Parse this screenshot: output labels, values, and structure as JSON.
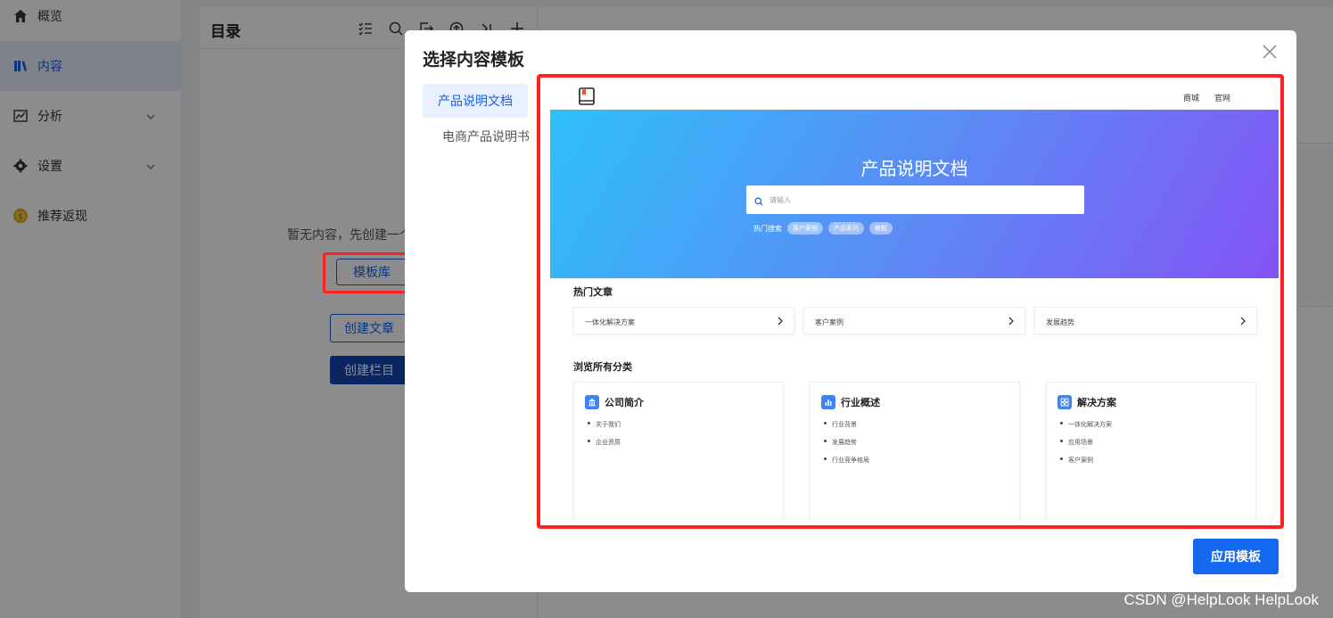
{
  "sidebar": {
    "items": [
      {
        "label": "概览",
        "icon": "home-icon"
      },
      {
        "label": "内容",
        "icon": "book-icon",
        "active": true
      },
      {
        "label": "分析",
        "icon": "chart-line-icon"
      },
      {
        "label": "设置",
        "icon": "gear-icon"
      },
      {
        "label": "推荐返现",
        "icon": "coin-icon"
      }
    ]
  },
  "directory": {
    "title": "目录",
    "empty_text": "暂无内容，先创建一个",
    "template_lib_button": "模板库",
    "create_article_button": "创建文章",
    "create_column_button": "创建栏目"
  },
  "modal": {
    "title": "选择内容模板",
    "templates": [
      {
        "label": "产品说明文档",
        "active": true
      },
      {
        "label": "电商产品说明书"
      }
    ],
    "apply_button": "应用模板",
    "preview": {
      "nav": [
        "商城",
        "官网"
      ],
      "hero_title": "产品说明文档",
      "search_placeholder": "请输入",
      "hot_label": "热门搜索",
      "hot_tags": [
        "客户案例",
        "产品系列",
        "教程"
      ],
      "hot_articles_title": "热门文章",
      "articles": [
        "一体化解决方案",
        "客户案例",
        "发展趋势"
      ],
      "categories_title": "浏览所有分类",
      "categories": [
        {
          "title": "公司简介",
          "items": [
            "关于我们",
            "企业资质"
          ]
        },
        {
          "title": "行业概述",
          "items": [
            "行业背景",
            "发展趋势",
            "行业竞争格局"
          ]
        },
        {
          "title": "解决方案",
          "items": [
            "一体化解决方案",
            "应用场景",
            "客户案例"
          ]
        }
      ]
    }
  },
  "watermark": "CSDN @HelpLook HelpLook",
  "colors": {
    "accent": "#1a5fe0",
    "highlight": "#ff2020",
    "apply": "#1569f0"
  }
}
